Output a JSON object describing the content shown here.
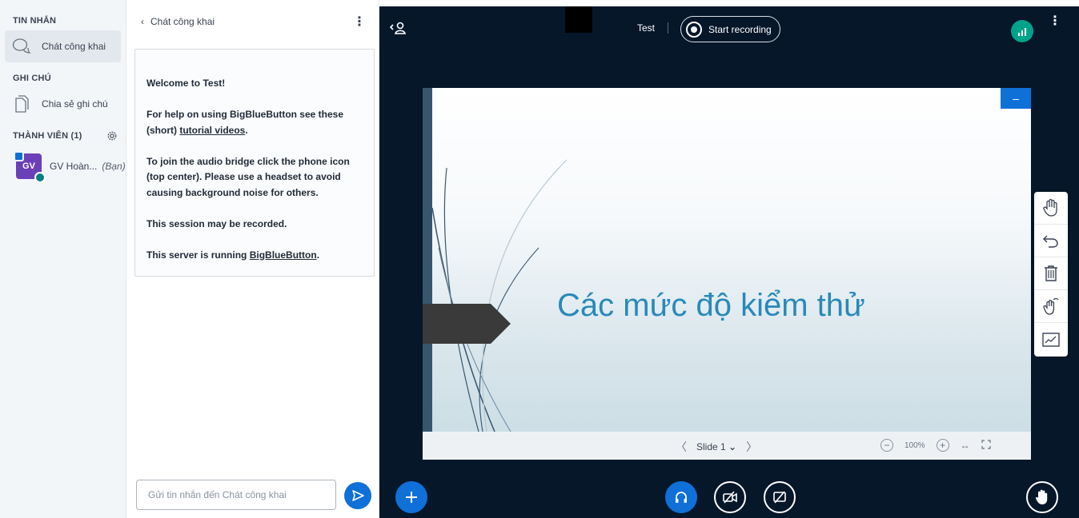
{
  "userlist": {
    "messages_title": "TIN NHẮN",
    "public_chat": "Chát công khai",
    "notes_title": "GHI CHÚ",
    "shared_notes": "Chia sẻ ghi chú",
    "members_title": "THÀNH VIÊN (1)",
    "user": {
      "initials": "GV",
      "name": "GV Hoàn...",
      "you_label": "(Bạn)"
    }
  },
  "chat": {
    "header_title": "Chát công khai",
    "welcome": {
      "line1": "Welcome to Test!",
      "help_prefix": "For help on using BigBlueButton see these (short) ",
      "help_link": "tutorial videos",
      "help_suffix": ".",
      "audio": "To join the audio bridge click the phone icon (top center). Please use a headset to avoid causing background noise for others.",
      "recorded": "This session may be recorded.",
      "server_prefix": "This server is running ",
      "server_link": "BigBlueButton",
      "server_suffix": "."
    },
    "input_placeholder": "Gửi tin nhắn đến Chát công khai"
  },
  "topbar": {
    "meeting_title": "Test",
    "record_label": "Start recording"
  },
  "presentation": {
    "slide_title": "Các mức độ kiểm thử",
    "slide_label": "Slide 1",
    "zoom": "100%",
    "minimize_label": "–"
  },
  "colors": {
    "accent": "#0f70d7",
    "main_bg": "#06172a",
    "connection": "#00a38a",
    "avatar": "#6a3fb8"
  },
  "icons": [
    "chat-icon",
    "notes-icon",
    "gear-icon",
    "send-icon",
    "hand-icon",
    "undo-icon",
    "trash-icon",
    "multiuser-icon",
    "chart-icon",
    "headphone-icon",
    "camera-off-icon",
    "screenshare-off-icon",
    "raise-hand-icon"
  ]
}
